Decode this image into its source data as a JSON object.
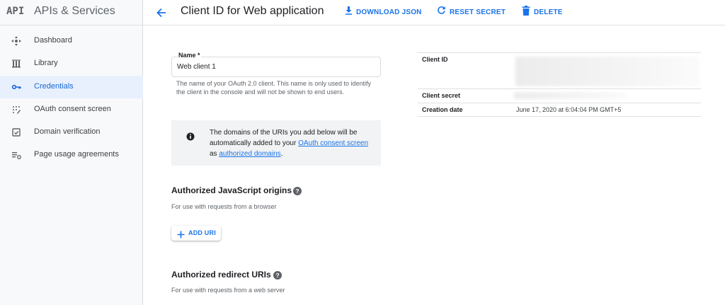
{
  "sidebar": {
    "logo": "API",
    "title": "APIs & Services",
    "items": [
      {
        "label": "Dashboard",
        "icon": "dashboard-icon"
      },
      {
        "label": "Library",
        "icon": "library-icon"
      },
      {
        "label": "Credentials",
        "icon": "key-icon",
        "active": true
      },
      {
        "label": "OAuth consent screen",
        "icon": "consent-icon"
      },
      {
        "label": "Domain verification",
        "icon": "checkbox-icon"
      },
      {
        "label": "Page usage agreements",
        "icon": "settings-list-icon"
      }
    ]
  },
  "header": {
    "title": "Client ID for Web application",
    "download_label": "DOWNLOAD JSON",
    "reset_label": "RESET SECRET",
    "delete_label": "DELETE"
  },
  "form": {
    "name_label": "Name *",
    "name_value": "Web client 1",
    "name_hint": "The name of your OAuth 2.0 client. This name is only used to identify the client in the console and will not be shown to end users.",
    "info_pre": "The domains of the URIs you add below will be automatically added to your ",
    "info_link1": "OAuth consent screen",
    "info_mid": " as ",
    "info_link2": "authorized domains",
    "info_post": ".",
    "js_origins_title": "Authorized JavaScript origins",
    "js_origins_sub": "For use with requests from a browser",
    "add_uri_label": "ADD URI",
    "redirect_title": "Authorized redirect URIs",
    "redirect_sub": "For use with requests from a web server"
  },
  "details": {
    "client_id_label": "Client ID",
    "client_secret_label": "Client secret",
    "creation_date_label": "Creation date",
    "creation_date_value": "June 17, 2020 at 6:04:04 PM GMT+5"
  },
  "colors": {
    "accent": "#1a73e8",
    "active_bg": "#e8f0fe",
    "sidebar_bg": "#f8f9fa"
  }
}
